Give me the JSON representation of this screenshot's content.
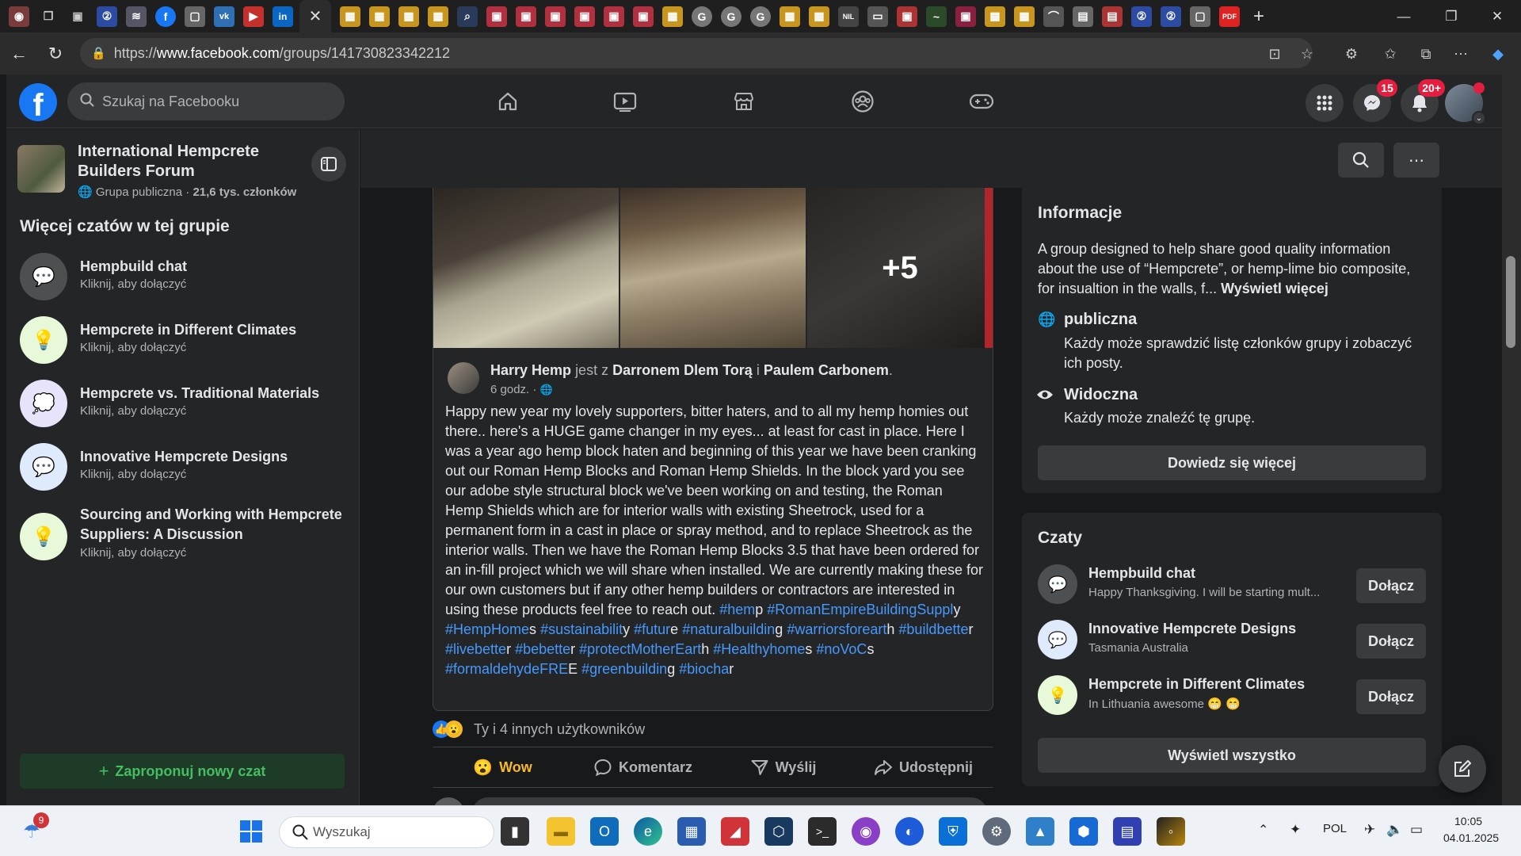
{
  "browser": {
    "url_prefix": "https://",
    "url_domain": "www.facebook.com",
    "url_path": "/groups/141730823342212",
    "tab_close": "✕",
    "new_tab": "+"
  },
  "header": {
    "logo": "f",
    "search_placeholder": "Szukaj na Facebooku",
    "messenger_badge": "15",
    "notifications_badge": "20+"
  },
  "group": {
    "name": "International Hempcrete Builders Forum",
    "privacy": "Grupa publiczna",
    "members": "21,6 tys. członków"
  },
  "sidebar": {
    "section_title": "Więcej czatów w tej grupie",
    "chats": [
      {
        "name": "Hempbuild chat",
        "sub": "Kliknij, aby dołączyć"
      },
      {
        "name": "Hempcrete in Different Climates",
        "sub": "Kliknij, aby dołączyć"
      },
      {
        "name": "Hempcrete vs. Traditional Materials",
        "sub": "Kliknij, aby dołączyć"
      },
      {
        "name": "Innovative Hempcrete Designs",
        "sub": "Kliknij, aby dołączyć"
      },
      {
        "name": "Sourcing and Working with Hempcrete Suppliers: A Discussion",
        "sub": "Kliknij, aby dołączyć"
      }
    ],
    "propose_button": "Zaproponuj nowy czat"
  },
  "post": {
    "more_photos": "+5",
    "author": "Harry Hemp",
    "with_text": "jest z",
    "tagged1": "Darronem Dlem Torą",
    "and_text": "i",
    "tagged2": "Paulem Carbonem",
    "time": "6 godz. ·",
    "body": "Happy new year my lovely supporters, bitter haters, and to all my hemp homies out there.. here's a HUGE game changer in my eyes... at least for cast in place. Here I was a year ago hemp block haten and beginning of this year we have been cranking out our Roman Hemp Blocks and Roman Hemp Shields. In the block yard you see our adobe style structural block we've been working on and testing, the Roman Hemp Shields which are for interior walls with existing Sheetrock, used for a permanent form in a cast in place or spray method, and to replace Sheetrock as the interior walls. Then we have the Roman Hemp Blocks 3.5 that have been ordered for an in-fill project which we will share when installed. We are currently making these for our own customers but if any other hemp builders or contractors are interested in using these products feel free to reach out.",
    "hashtags": [
      {
        "tag": "#hem",
        "tail": "p"
      },
      {
        "tag": "#RomanEmpireBuildingSuppl",
        "tail": "y"
      },
      {
        "tag": "#HempHome",
        "tail": "s"
      },
      {
        "tag": "#sustainabilit",
        "tail": "y"
      },
      {
        "tag": "#futur",
        "tail": "e"
      },
      {
        "tag": "#naturalbuildin",
        "tail": "g"
      },
      {
        "tag": "#warriorsforeart",
        "tail": "h"
      },
      {
        "tag": "#buildbette",
        "tail": "r"
      },
      {
        "tag": "#livebette",
        "tail": "r"
      },
      {
        "tag": "#bebette",
        "tail": "r"
      },
      {
        "tag": "#protectMotherEart",
        "tail": "h"
      },
      {
        "tag": "#Healthyhome",
        "tail": "s"
      },
      {
        "tag": "#noVoC",
        "tail": "s"
      },
      {
        "tag": "#formaldehydeFRE",
        "tail": "E"
      },
      {
        "tag": "#greenbuildin",
        "tail": "g"
      },
      {
        "tag": "#biocha",
        "tail": "r"
      }
    ],
    "reactions_text": "Ty i 4 innych użytkowników",
    "actions": {
      "wow": "Wow",
      "comment": "Komentarz",
      "send": "Wyślij",
      "share": "Udostępnij"
    }
  },
  "info": {
    "title": "Informacje",
    "description": "A group designed to help share good quality information about the use of “Hempcrete”, or hemp-lime bio composite, for insualtion in the walls, f...",
    "see_more": "Wyświetl więcej",
    "public_title": "publiczna",
    "public_desc": "Każdy może sprawdzić listę członków grupy i zobaczyć ich posty.",
    "visible_title": "Widoczna",
    "visible_desc": "Każdy może znaleźć tę grupę.",
    "learn_more": "Dowiedz się więcej"
  },
  "chats_card": {
    "title": "Czaty",
    "items": [
      {
        "name": "Hempbuild chat",
        "sub": "Happy Thanksgiving. I will be starting mult...",
        "join": "Dołącz"
      },
      {
        "name": "Innovative Hempcrete Designs",
        "sub": "Tasmania Australia",
        "join": "Dołącz"
      },
      {
        "name": "Hempcrete in Different Climates",
        "sub": "In Lithuania awesome 😁 😁",
        "join": "Dołącz"
      }
    ],
    "see_all": "Wyświetl wszystko"
  },
  "taskbar": {
    "search": "Wyszukaj",
    "weather_badge": "9",
    "lang": "POL",
    "time": "10:05",
    "date": "04.01.2025"
  },
  "colors": {
    "accent": "#1877f2",
    "hashtag": "#4599ff",
    "join_green": "#45bd62"
  }
}
